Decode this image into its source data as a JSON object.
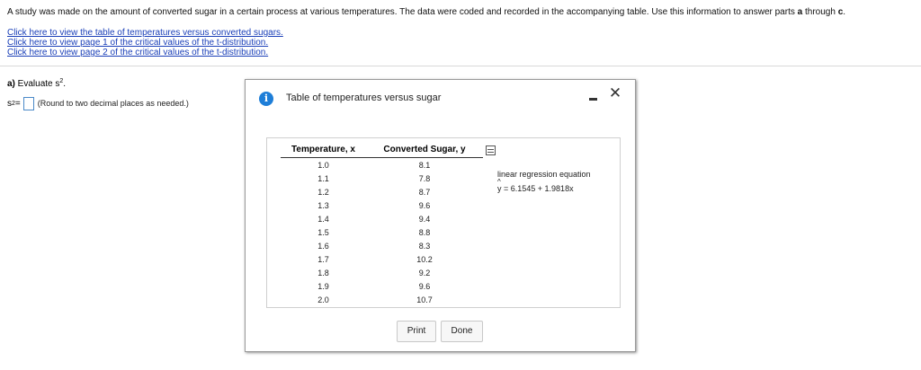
{
  "problem": {
    "intro_text": "A study was made on the amount of converted sugar in a certain process at various temperatures. The data were coded and recorded in the accompanying table. Use this information to answer parts ",
    "intro_bold_a": "a",
    "intro_mid": " through ",
    "intro_bold_c": "c",
    "intro_end": "."
  },
  "links": [
    "Click here to view the table of temperatures versus converted sugars.",
    "Click here to view page 1 of the critical values of the t-distribution.",
    "Click here to view page 2 of the critical values of the t-distribution."
  ],
  "part_a": {
    "label": "a)",
    "prompt": " Evaluate s",
    "prompt_sup": "2",
    "prompt_end": ".",
    "answer_prefix": "s",
    "answer_sup": "2",
    "answer_eq": " =",
    "hint": "(Round to two decimal places as needed.)"
  },
  "dialog": {
    "title": "Table of temperatures versus sugar",
    "info_icon": "i",
    "close_icon": "✕",
    "table": {
      "headers": [
        "Temperature, x",
        "Converted Sugar, y"
      ],
      "rows": [
        [
          "1.0",
          "8.1"
        ],
        [
          "1.1",
          "7.8"
        ],
        [
          "1.2",
          "8.7"
        ],
        [
          "1.3",
          "9.6"
        ],
        [
          "1.4",
          "9.4"
        ],
        [
          "1.5",
          "8.8"
        ],
        [
          "1.6",
          "8.3"
        ],
        [
          "1.7",
          "10.2"
        ],
        [
          "1.8",
          "9.2"
        ],
        [
          "1.9",
          "9.6"
        ],
        [
          "2.0",
          "10.7"
        ]
      ]
    },
    "regression_label": "linear regression equation",
    "regression_y": "y",
    "regression_eq": " = 6.1545 + 1.9818x",
    "print_label": "Print",
    "done_label": "Done"
  },
  "colors": {
    "link": "#1a3fb8",
    "info_icon": "#1e7ed8",
    "answer_box_border": "#4a89c8"
  }
}
